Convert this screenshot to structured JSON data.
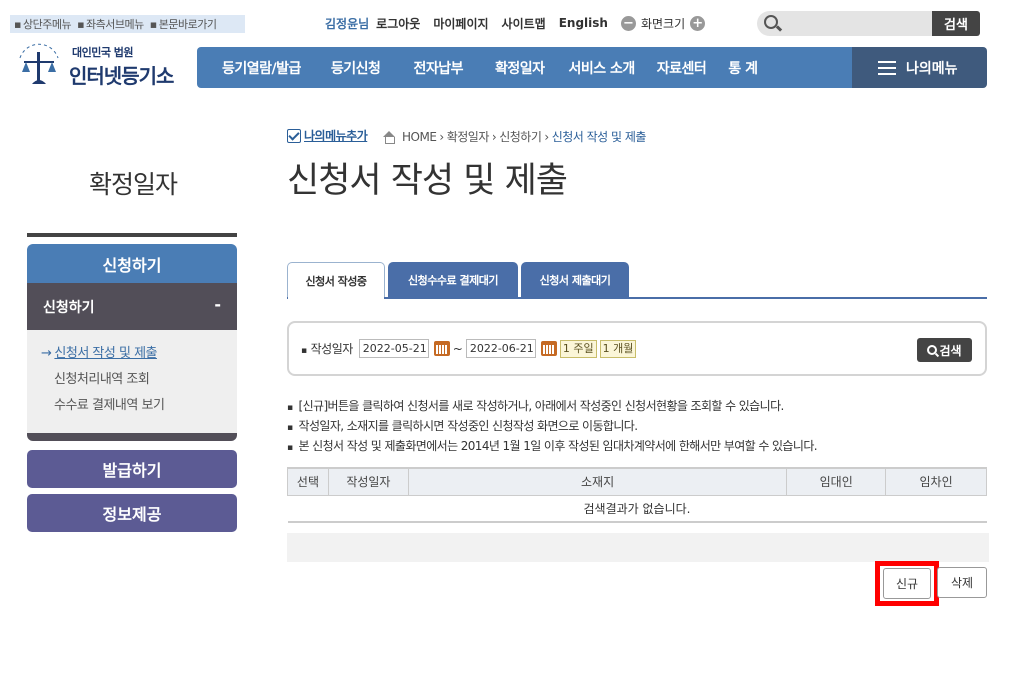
{
  "skip_links": [
    "상단주메뉴",
    "좌측서브메뉴",
    "본문바로가기"
  ],
  "util": {
    "user": "김정윤님",
    "logout": "로그아웃",
    "mypage": "마이페이지",
    "sitemap": "사이트맵",
    "english": "English",
    "font_size": "화면크기",
    "search_placeholder": "",
    "search_button": "검색"
  },
  "logo": {
    "court": "대인민국 법원",
    "name": "인터넷등기소",
    "emblem_arc": "대 한 민 국 법 원"
  },
  "gnb": [
    "등기열람/발급",
    "등기신청",
    "전자납부",
    "확정일자",
    "서비스 소개",
    "자료센터",
    "통 계"
  ],
  "my_menu": "나의메뉴",
  "lnb": {
    "title": "확정일자",
    "section1": "신청하기",
    "sub1": "신청하기",
    "items": [
      "신청서 작성 및 제출",
      "신청처리내역 조회",
      "수수료 결제내역 보기"
    ],
    "section2": "발급하기",
    "section3": "정보제공"
  },
  "breadcrumb": {
    "add_menu": "나의메뉴추가",
    "items": [
      "HOME",
      "확정일자",
      "신청하기",
      "신청서 작성 및 제출"
    ]
  },
  "page_title": "신청서 작성 및 제출",
  "tabs": [
    "신청서 작성중",
    "신청수수료 결제대기",
    "신청서 제출대기"
  ],
  "search": {
    "label": "작성일자",
    "date_from": "2022-05-21",
    "date_to": "2022-06-21",
    "tilde": "~",
    "week": "1 주일",
    "month": "1 개월",
    "button": "검색"
  },
  "notes": [
    "[신규]버튼을 클릭하여 신청서를 새로 작성하거나, 아래에서 작성중인 신청서현황을 조회할 수 있습니다.",
    "작성일자, 소재지를 클릭하시면 작성중인 신청작성 화면으로 이동합니다.",
    "본 신청서 작성 및 제출화면에서는 2014년 1월 1일 이후 작성된 임대차계약서에 한해서만 부여할 수 있습니다."
  ],
  "table": {
    "headers": [
      "선택",
      "작성일자",
      "소재지",
      "임대인",
      "임차인"
    ],
    "empty": "검색결과가 없습니다."
  },
  "buttons": {
    "new": "신규",
    "delete": "삭제"
  },
  "colors": {
    "gnb": "#4a7db5",
    "highlight": "#ff0000",
    "lnb_sub": "#5c5b94"
  }
}
